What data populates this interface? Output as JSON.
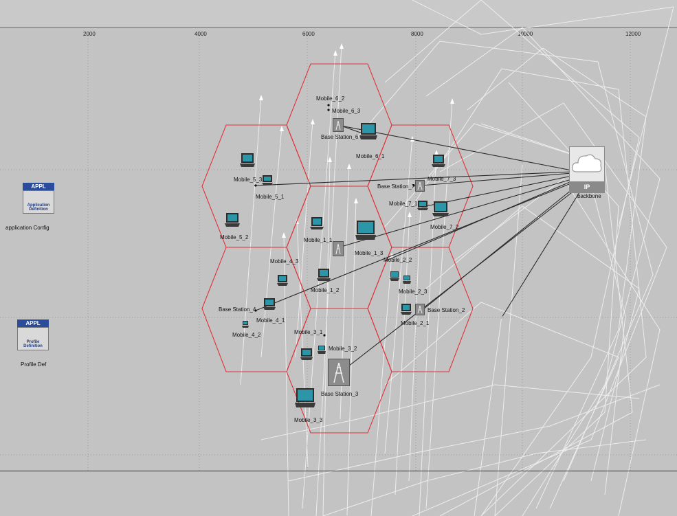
{
  "ruler": {
    "ticks": [
      "2000",
      "4000",
      "6000",
      "8000",
      "10000",
      "12000"
    ]
  },
  "app_objects": {
    "application": {
      "badge": "APPL",
      "caption_top": "Application",
      "caption_bottom": "Definition",
      "label": "application Config"
    },
    "profile": {
      "badge": "APPL",
      "caption_top": "Profile",
      "caption_bottom": "Definition",
      "label": "Profile Def"
    }
  },
  "backbone": {
    "tag": "IP",
    "label": "backbone"
  },
  "nodes": {
    "mobile_6_2": "Mobile_6_2",
    "mobile_6_3": "Mobile_6_3",
    "base_station_6": "Base Station_6",
    "mobile_6_1": "Mobile_6_1",
    "mobile_5_3": "Mobile_5_3",
    "mobile_5_1": "Mobile_5_1",
    "mobile_5_2": "Mobile_5_2",
    "base_station_7": "Base Station_7",
    "mobile_7_3": "Mobile_7_3",
    "mobile_7_1": "Mobile_7_1",
    "mobile_7_2": "Mobile_7_2",
    "mobile_1_1": "Mobile_1_1",
    "mobile_1_3": "Mobile_1_3",
    "mobile_1_2": "Mobile_1_2",
    "mobile_4_3": "Mobile_4_3",
    "base_station_4": "Base Station_4",
    "mobile_4_1": "Mobile_4_1",
    "mobile_4_2": "Mobile_4_2",
    "mobile_2_2": "Mobile_2_2",
    "mobile_2_3": "Mobile_2_3",
    "base_station_2": "Base Station_2",
    "mobile_2_1": "Mobile_2_1",
    "mobile_3_1": "Mobile_3_1",
    "mobile_3_2": "Mobile_3_2",
    "base_station_3": "Base Station_3",
    "mobile_3_3": "Mobile_3_3"
  },
  "colors": {
    "canvas": "#c3c3c3",
    "hex_border": "#e0323a",
    "trajectory": "#f4f4f4",
    "link": "#2b2b2b",
    "appl_header": "#2a4c9a"
  }
}
